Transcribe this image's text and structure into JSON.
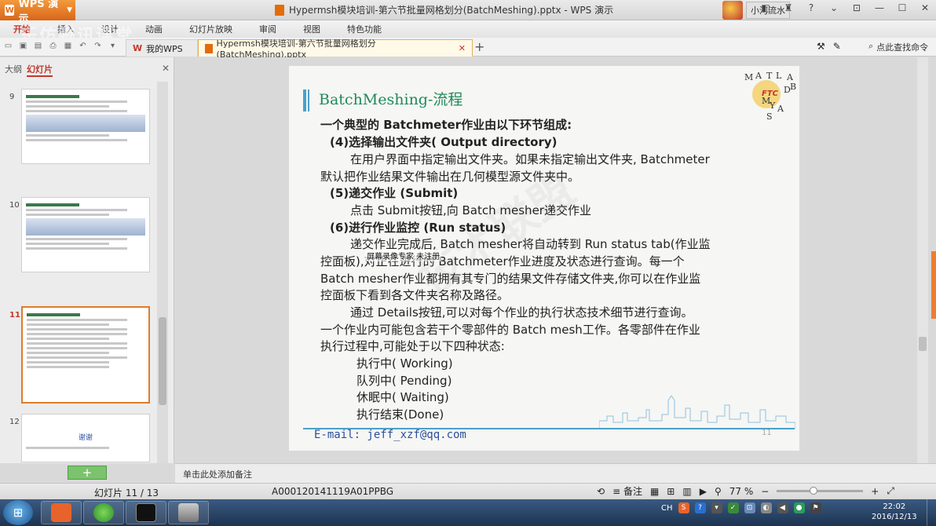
{
  "titlebar": {
    "app_name": "WPS 演示",
    "doc_title": "Hypermsh模块培训-第六节批量网格划分(BatchMeshing).pptx - WPS 演示",
    "user_name": "小河流水"
  },
  "menu": [
    "开始",
    "插入",
    "设计",
    "动画",
    "幻灯片放映",
    "审阅",
    "视图",
    "特色功能"
  ],
  "watermark_top": "乐仿腾讯课堂",
  "tabs": {
    "my_wps": "我的WPS",
    "doc": "Hypermsh模块培训-第六节批量网格划分(BatchMeshing).pptx"
  },
  "search_cmd": "点此查找命令",
  "left_panel": {
    "tab_outline": "大纲",
    "tab_slides": "幻灯片",
    "slides": [
      {
        "num": "9",
        "selected": false
      },
      {
        "num": "10",
        "selected": false
      },
      {
        "num": "11",
        "selected": true
      },
      {
        "num": "12",
        "selected": false,
        "text": "谢谢"
      }
    ]
  },
  "slide": {
    "title": "BatchMeshing-流程",
    "logo_letters": [
      "M",
      "A",
      "T",
      "L",
      "A",
      "B",
      "FTC",
      "D",
      "Y",
      "M",
      "A",
      "S"
    ],
    "lines": [
      "一个典型的 Batchmeter作业由以下环节组成:",
      "(4)选择输出文件夹( Output directory)",
      "在用户界面中指定输出文件夹。如果未指定输出文件夹, Batchmeter",
      "默认把作业结果文件输出在几何模型源文件夹中。",
      "(5)递交作业 (Submit)",
      "点击 Submit按钮,向 Batch mesher递交作业",
      "(6)进行作业监控 (Run status)",
      "递交作业完成后, Batch mesher将自动转到 Run status tab(作业监",
      "控面板),对正在进行的 Batchmeter作业进度及状态进行查询。每一个",
      "Batch mesher作业都拥有其专门的结果文件存储文件夹,你可以在作业监",
      "控面板下看到各文件夹名称及路径。",
      "通过 Details按钮,可以对每个作业的执行状态技术细节进行查询。",
      "一个作业内可能包含若干个零部件的 Batch mesh工作。各零部件在作业",
      "执行过程中,可能处于以下四种状态:",
      "执行中( Working)",
      "队列中( Pending)",
      "休眠中( Waiting)",
      "执行结束(Done)"
    ],
    "email": "E-mail: jeff_xzf@qq.com",
    "page_number": "11",
    "watermark": "技术联盟"
  },
  "overlay_note": "屏幕录像专家 未注册",
  "notes_placeholder": "单击此处添加备注",
  "status": {
    "slide_info": "幻灯片 11 / 13",
    "code": "A000120141119A01PPBG",
    "notes_label": "备注",
    "zoom": "77 %"
  },
  "taskbar": {
    "lang": "CH",
    "time": "22:02",
    "date": "2016/12/13"
  },
  "colors": {
    "accent_orange": "#e07b2a",
    "slide_title_green": "#1f8a5a",
    "slide_line_blue": "#4aa0c8",
    "taskbar": "#1c3350"
  }
}
